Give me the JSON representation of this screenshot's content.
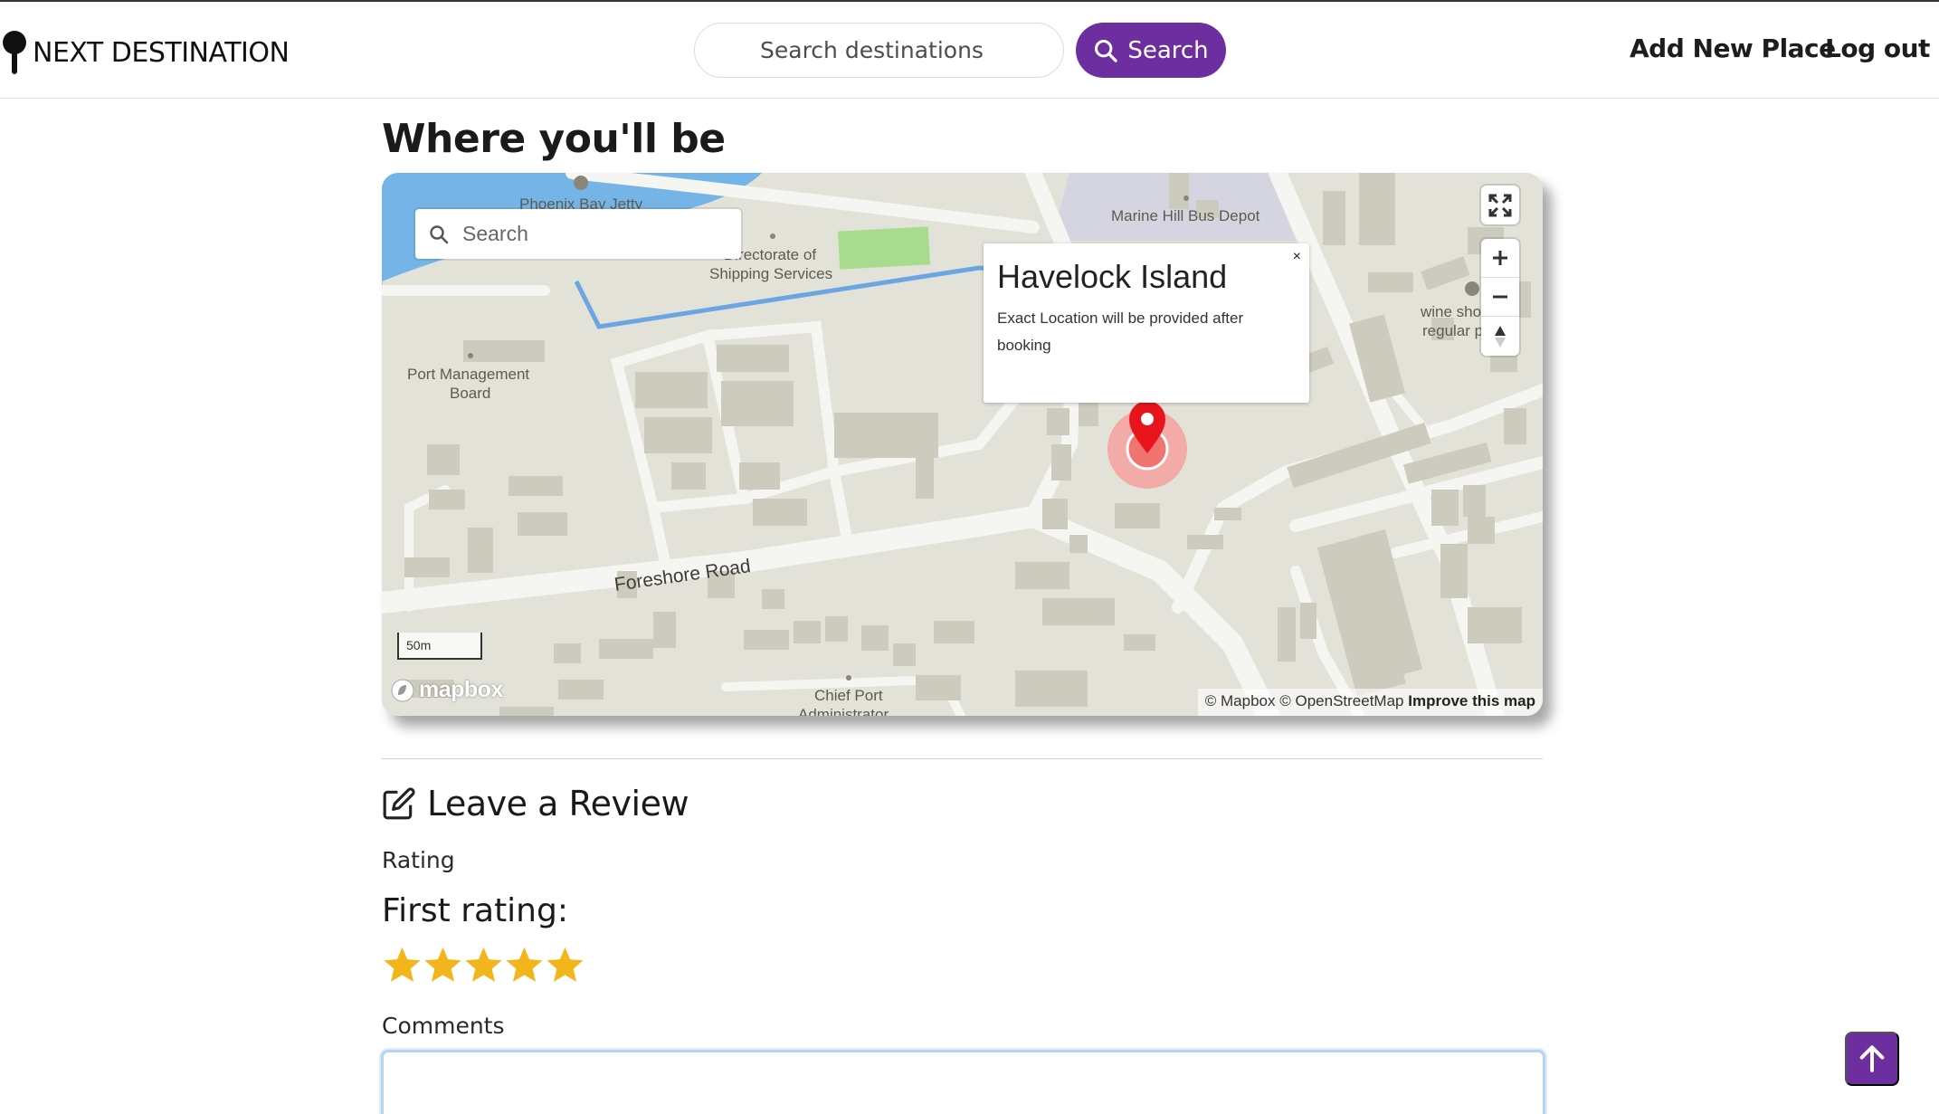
{
  "navbar": {
    "brand": "NEXT DESTINATION",
    "search_placeholder": "Search destinations",
    "search_button": "Search",
    "add_new_place": "Add New Place",
    "log_out": "Log out"
  },
  "location": {
    "heading": "Where you'll be",
    "map": {
      "search_placeholder": "Search",
      "popup_title": "Havelock Island",
      "popup_text": "Exact Location will be provided after booking",
      "popup_close": "×",
      "scale_label": "50m",
      "logo_text": "mapbox",
      "attribution_mapbox": "© Mapbox",
      "attribution_osm": "© OpenStreetMap",
      "attribution_improve": "Improve this map",
      "labels": {
        "phoenix_bay_jetty": "Phoenix Bay Jetty",
        "directorate_1": "Directorate of",
        "directorate_2": "Shipping Services",
        "marine_hill": "Marine Hill Bus Depot",
        "port_management_1": "Port Management",
        "port_management_2": "Board",
        "wine_shop_1": "wine shop",
        "wine_shop_2": "regular p",
        "foreshore_road": "Foreshore Road",
        "chief_port_1": "Chief Port",
        "chief_port_2": "Administrator"
      }
    }
  },
  "review": {
    "heading": "Leave a Review",
    "rating_label": "Rating",
    "first_rating_label": "First rating:",
    "rating_value": 5,
    "rating_max": 5,
    "comments_label": "Comments",
    "comments_value": ""
  },
  "colors": {
    "brand_purple": "#6d2fa0",
    "star": "#f3b51c",
    "marker_red": "#e8141b"
  }
}
